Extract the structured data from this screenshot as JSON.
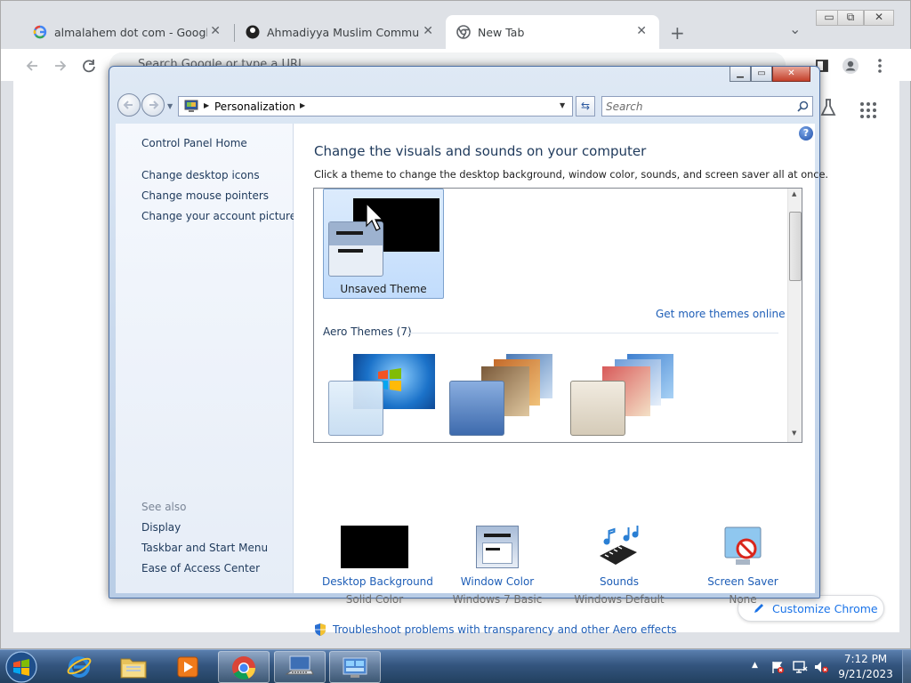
{
  "chrome": {
    "tabs": [
      {
        "title": "almalahem dot com - Google Se",
        "close": "✕"
      },
      {
        "title": "Ahmadiyya Muslim Community -",
        "close": "✕"
      },
      {
        "title": "New Tab",
        "close": "✕"
      }
    ],
    "new_tab": "+",
    "tab_search": "⌄",
    "window_controls": {
      "minimize": "▭",
      "restore": "⧉",
      "close": "✕"
    },
    "omnibox_placeholder": "Search Google or type a URL",
    "customize_label": "Customize Chrome"
  },
  "explorer": {
    "caption": {
      "minimize": "▁",
      "maximize": "▭",
      "close": "✕"
    },
    "breadcrumb": "Personalization",
    "search_placeholder": "Search",
    "help": "?",
    "left_links": [
      "Control Panel Home",
      "Change desktop icons",
      "Change mouse pointers",
      "Change your account picture"
    ],
    "see_also_title": "See also",
    "see_also_links": [
      "Display",
      "Taskbar and Start Menu",
      "Ease of Access Center"
    ],
    "heading": "Change the visuals and sounds on your computer",
    "subheading": "Click a theme to change the desktop background, window color, sounds, and screen saver all at once.",
    "unsaved_theme": "Unsaved Theme",
    "get_more": "Get more themes online",
    "aero_themes": "Aero Themes (7)",
    "bottom_items": [
      {
        "label": "Desktop Background",
        "sub": "Solid Color"
      },
      {
        "label": "Window Color",
        "sub": "Windows 7 Basic"
      },
      {
        "label": "Sounds",
        "sub": "Windows Default"
      },
      {
        "label": "Screen Saver",
        "sub": "None"
      }
    ],
    "troubleshoot": "Troubleshoot problems with transparency and other Aero effects"
  },
  "taskbar": {
    "time": "7:12 PM",
    "date": "9/21/2023"
  },
  "colors": {
    "link_blue": "#1e5eb7",
    "selection": "#c1dcfc",
    "chrome_bg": "#dee1e6"
  }
}
